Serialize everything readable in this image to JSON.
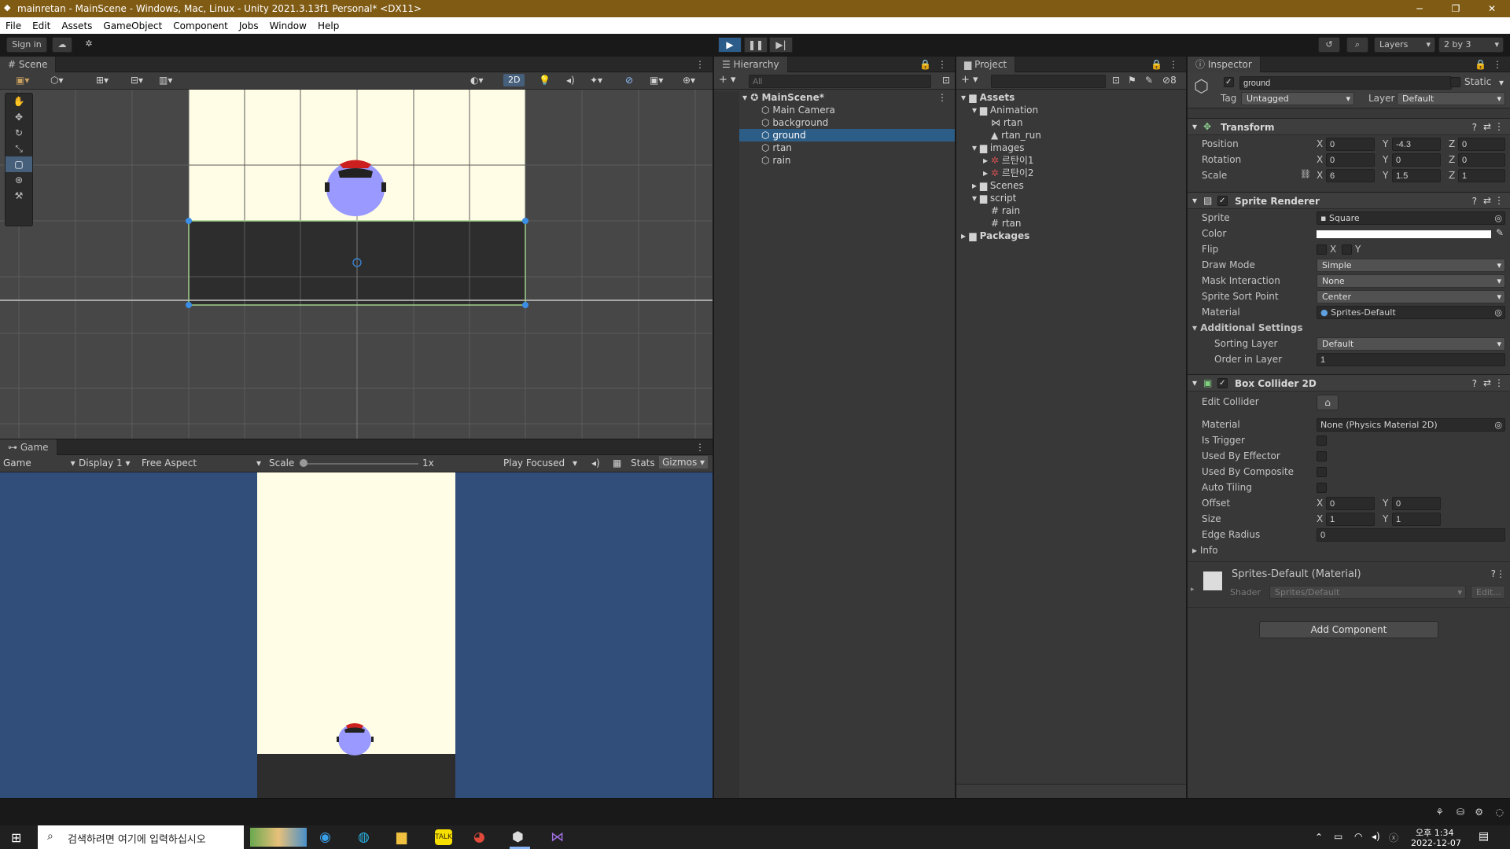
{
  "window": {
    "title": "mainretan - MainScene - Windows, Mac, Linux - Unity 2021.3.13f1 Personal* <DX11>",
    "controls": [
      "─",
      "❐",
      "✕"
    ]
  },
  "menu": [
    "File",
    "Edit",
    "Assets",
    "GameObject",
    "Component",
    "Jobs",
    "Window",
    "Help"
  ],
  "toolbar": {
    "sign_in": "Sign in",
    "layers": "Layers",
    "layout": "2 by 3"
  },
  "scene": {
    "tab": "Scene",
    "mode_2d": "2D"
  },
  "game": {
    "tab": "Game",
    "view_select": "Game",
    "display": "Display 1",
    "aspect": "Free Aspect",
    "scale_label": "Scale",
    "scale_value": "1x",
    "play_focused": "Play Focused",
    "stats": "Stats",
    "gizmos": "Gizmos"
  },
  "hierarchy": {
    "tab": "Hierarchy",
    "search_placeholder": "All",
    "scene_name": "MainScene*",
    "items": [
      "Main Camera",
      "background",
      "ground",
      "rtan",
      "rain"
    ],
    "selected": "ground"
  },
  "project": {
    "tab": "Project",
    "badge": "8",
    "tree": {
      "assets": "Assets",
      "animation": "Animation",
      "anim_rtan": "rtan",
      "anim_rtan_run": "rtan_run",
      "images": "images",
      "img1": "르탄이1",
      "img2": "르탄이2",
      "scenes": "Scenes",
      "script": "script",
      "script_rain": "rain",
      "script_rtan": "rtan",
      "packages": "Packages"
    }
  },
  "inspector": {
    "tab": "Inspector",
    "object_name": "ground",
    "static_label": "Static",
    "tag_label": "Tag",
    "tag_value": "Untagged",
    "layer_label": "Layer",
    "layer_value": "Default",
    "transform": {
      "title": "Transform",
      "position_label": "Position",
      "rotation_label": "Rotation",
      "scale_label": "Scale",
      "position": {
        "x": "0",
        "y": "-4.3",
        "z": "0"
      },
      "rotation": {
        "x": "0",
        "y": "0",
        "z": "0"
      },
      "scale": {
        "x": "6",
        "y": "1.5",
        "z": "1"
      }
    },
    "sprite_renderer": {
      "title": "Sprite Renderer",
      "sprite_label": "Sprite",
      "sprite_value": "Square",
      "color_label": "Color",
      "flip_label": "Flip",
      "flip_x": "X",
      "flip_y": "Y",
      "draw_mode_label": "Draw Mode",
      "draw_mode_value": "Simple",
      "mask_label": "Mask Interaction",
      "mask_value": "None",
      "sort_point_label": "Sprite Sort Point",
      "sort_point_value": "Center",
      "material_label": "Material",
      "material_value": "Sprites-Default",
      "additional_label": "Additional Settings",
      "sorting_layer_label": "Sorting Layer",
      "sorting_layer_value": "Default",
      "order_label": "Order in Layer",
      "order_value": "1"
    },
    "box_collider": {
      "title": "Box Collider 2D",
      "edit_label": "Edit Collider",
      "material_label": "Material",
      "material_value": "None (Physics Material 2D)",
      "trigger_label": "Is Trigger",
      "effector_label": "Used By Effector",
      "composite_label": "Used By Composite",
      "tiling_label": "Auto Tiling",
      "offset_label": "Offset",
      "offset_x": "0",
      "offset_y": "0",
      "size_label": "Size",
      "size_x": "1",
      "size_y": "1",
      "edge_label": "Edge Radius",
      "edge_value": "0",
      "info_label": "Info"
    },
    "material": {
      "title": "Sprites-Default (Material)",
      "shader_label": "Shader",
      "shader_value": "Sprites/Default",
      "edit_label": "Edit..."
    },
    "add_component": "Add Component"
  },
  "taskbar": {
    "search_placeholder": "검색하려면 여기에 입력하십시오",
    "time": "오후 1:34",
    "date": "2022-12-07"
  },
  "colors": {
    "title_bar": "#805b14",
    "selection": "#2c5d87",
    "scene_bg": "#474747",
    "sky": "#fffde6",
    "ground": "#2d2d2d",
    "game_bg": "#314d79",
    "character": "#9999ff"
  }
}
